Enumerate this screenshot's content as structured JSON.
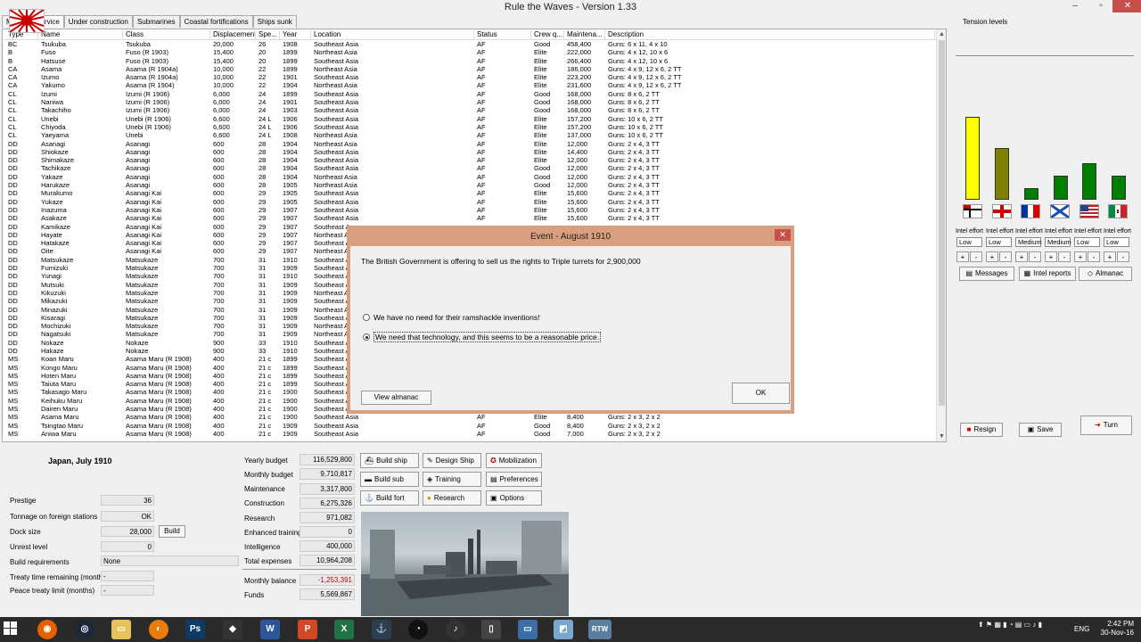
{
  "window": {
    "title": "Rule the Waves - Version 1.33",
    "controls": [
      "–",
      "▫",
      "✕"
    ]
  },
  "tabs": [
    "Map",
    "In service",
    "Under construction",
    "Submarines",
    "Coastal fortifications",
    "Ships sunk"
  ],
  "active_tab": "In service",
  "table": {
    "columns": [
      "Type",
      "Name",
      "Class",
      "Displacement",
      "Spe...",
      "Year",
      "Location",
      "Status",
      "Crew q...",
      "Maintena...",
      "Description"
    ],
    "rows": [
      [
        "BC",
        "Tsukuba",
        "Tsukuba",
        "20,000",
        "26",
        "1908",
        "Southeast Asia",
        "AF",
        "Good",
        "458,400",
        "Guns: 6 x 11, 4 x 10"
      ],
      [
        "B",
        "Fuso",
        "Fuso (R 1903)",
        "15,400",
        "20",
        "1899",
        "Northeast Asia",
        "AF",
        "Elite",
        "222,000",
        "Guns: 4 x 12, 10 x 6"
      ],
      [
        "B",
        "Hatsuse",
        "Fuso (R 1903)",
        "15,400",
        "20",
        "1899",
        "Southeast Asia",
        "AF",
        "Elite",
        "266,400",
        "Guns: 4 x 12, 10 x 6"
      ],
      [
        "CA",
        "Asama",
        "Asama (R 1904a)",
        "10,000",
        "22",
        "1899",
        "Northeast Asia",
        "AF",
        "Elite",
        "186,000",
        "Guns: 4 x 9, 12 x 6, 2 TT"
      ],
      [
        "CA",
        "Izumo",
        "Asama (R 1904a)",
        "10,000",
        "22",
        "1901",
        "Southeast Asia",
        "AF",
        "Elite",
        "223,200",
        "Guns: 4 x 9, 12 x 6, 2 TT"
      ],
      [
        "CA",
        "Yakumo",
        "Asama (R 1904)",
        "10,000",
        "22",
        "1904",
        "Northeast Asia",
        "AF",
        "Elite",
        "231,600",
        "Guns: 4 x 9, 12 x 6, 2 TT"
      ],
      [
        "CL",
        "Izumi",
        "Izumi (R 1906)",
        "6,000",
        "24",
        "1899",
        "Southeast Asia",
        "AF",
        "Good",
        "168,000",
        "Guns: 8 x 6, 2 TT"
      ],
      [
        "CL",
        "Naniwa",
        "Izumi (R 1906)",
        "6,000",
        "24",
        "1901",
        "Southeast Asia",
        "AF",
        "Good",
        "168,000",
        "Guns: 8 x 6, 2 TT"
      ],
      [
        "CL",
        "Takachiho",
        "Izumi (R 1906)",
        "6,000",
        "24",
        "1903",
        "Southeast Asia",
        "AF",
        "Good",
        "168,000",
        "Guns: 8 x 6, 2 TT"
      ],
      [
        "CL",
        "Unebi",
        "Unebi (R 1906)",
        "6,600",
        "24 L",
        "1906",
        "Southeast Asia",
        "AF",
        "Elite",
        "157,200",
        "Guns: 10 x 6, 2 TT"
      ],
      [
        "CL",
        "Chiyoda",
        "Unebi (R 1906)",
        "6,600",
        "24 L",
        "1906",
        "Southeast Asia",
        "AF",
        "Elite",
        "157,200",
        "Guns: 10 x 6, 2 TT"
      ],
      [
        "CL",
        "Yaeyama",
        "Unebi",
        "6,600",
        "24 L",
        "1908",
        "Northeast Asia",
        "AF",
        "Elite",
        "137,000",
        "Guns: 10 x 6, 2 TT"
      ],
      [
        "DD",
        "Asanagi",
        "Asanagi",
        "600",
        "28",
        "1904",
        "Northeast Asia",
        "AF",
        "Elite",
        "12,000",
        "Guns: 2 x 4, 3 TT"
      ],
      [
        "DD",
        "Shiokaze",
        "Asanagi",
        "600",
        "28",
        "1904",
        "Southeast Asia",
        "AF",
        "Elite",
        "14,400",
        "Guns: 2 x 4, 3 TT"
      ],
      [
        "DD",
        "Shimakaze",
        "Asanagi",
        "600",
        "28",
        "1904",
        "Southeast Asia",
        "AF",
        "Elite",
        "12,000",
        "Guns: 2 x 4, 3 TT"
      ],
      [
        "DD",
        "Tachikaze",
        "Asanagi",
        "600",
        "28",
        "1904",
        "Southeast Asia",
        "AF",
        "Good",
        "12,000",
        "Guns: 2 x 4, 3 TT"
      ],
      [
        "DD",
        "Yakaze",
        "Asanagi",
        "600",
        "28",
        "1904",
        "Northeast Asia",
        "AF",
        "Good",
        "12,000",
        "Guns: 2 x 4, 3 TT"
      ],
      [
        "DD",
        "Harukaze",
        "Asanagi",
        "600",
        "28",
        "1905",
        "Northeast Asia",
        "AF",
        "Good",
        "12,000",
        "Guns: 2 x 4, 3 TT"
      ],
      [
        "DD",
        "Murakumo",
        "Asanagi Kai",
        "600",
        "29",
        "1905",
        "Southeast Asia",
        "AF",
        "Elite",
        "15,600",
        "Guns: 2 x 4, 3 TT"
      ],
      [
        "DD",
        "Yukaze",
        "Asanagi Kai",
        "600",
        "29",
        "1905",
        "Southeast Asia",
        "AF",
        "Elite",
        "15,600",
        "Guns: 2 x 4, 3 TT"
      ],
      [
        "DD",
        "Inazuma",
        "Asanagi Kai",
        "600",
        "29",
        "1907",
        "Southeast Asia",
        "AF",
        "Elite",
        "15,600",
        "Guns: 2 x 4, 3 TT"
      ],
      [
        "DD",
        "Asakaze",
        "Asanagi Kai",
        "600",
        "29",
        "1907",
        "Southeast Asia",
        "AF",
        "Elite",
        "15,600",
        "Guns: 2 x 4, 3 TT"
      ],
      [
        "DD",
        "Kamikaze",
        "Asanagi Kai",
        "600",
        "29",
        "1907",
        "Southeast A",
        "",
        "",
        "",
        ""
      ],
      [
        "DD",
        "Hayate",
        "Asanagi Kai",
        "600",
        "29",
        "1907",
        "Northeast A",
        "",
        "",
        "",
        ""
      ],
      [
        "DD",
        "Hatakaze",
        "Asanagi Kai",
        "600",
        "29",
        "1907",
        "Southeast A",
        "",
        "",
        "",
        ""
      ],
      [
        "DD",
        "Oite",
        "Asanagi Kai",
        "600",
        "29",
        "1907",
        "Northeast A",
        "",
        "",
        "",
        ""
      ],
      [
        "DD",
        "Matsukaze",
        "Matsukaze",
        "700",
        "31",
        "1910",
        "Southeast A",
        "",
        "",
        "",
        ""
      ],
      [
        "DD",
        "Fumizuki",
        "Matsukaze",
        "700",
        "31",
        "1909",
        "Southeast A",
        "",
        "",
        "",
        ""
      ],
      [
        "DD",
        "Yunagi",
        "Matsukaze",
        "700",
        "31",
        "1910",
        "Southeast A",
        "",
        "",
        "",
        ""
      ],
      [
        "DD",
        "Mutsuki",
        "Matsukaze",
        "700",
        "31",
        "1909",
        "Southeast A",
        "",
        "",
        "",
        ""
      ],
      [
        "DD",
        "Kikuzuki",
        "Matsukaze",
        "700",
        "31",
        "1909",
        "Northeast A",
        "",
        "",
        "",
        ""
      ],
      [
        "DD",
        "Mikazuki",
        "Matsukaze",
        "700",
        "31",
        "1909",
        "Southeast A",
        "",
        "",
        "",
        ""
      ],
      [
        "DD",
        "Minazuki",
        "Matsukaze",
        "700",
        "31",
        "1909",
        "Northeast A",
        "",
        "",
        "",
        ""
      ],
      [
        "DD",
        "Kisaragi",
        "Matsukaze",
        "700",
        "31",
        "1909",
        "Southeast A",
        "",
        "",
        "",
        ""
      ],
      [
        "DD",
        "Mochizuki",
        "Matsukaze",
        "700",
        "31",
        "1909",
        "Northeast A",
        "",
        "",
        "",
        ""
      ],
      [
        "DD",
        "Nagatsuki",
        "Matsukaze",
        "700",
        "31",
        "1909",
        "Northeast A",
        "",
        "",
        "",
        ""
      ],
      [
        "DD",
        "Nokaze",
        "Nokaze",
        "900",
        "33",
        "1910",
        "Southeast A",
        "",
        "",
        "",
        ""
      ],
      [
        "DD",
        "Hakaze",
        "Nokaze",
        "900",
        "33",
        "1910",
        "Southeast A",
        "",
        "",
        "",
        ""
      ],
      [
        "MS",
        "Koan Maru",
        "Asama Maru (R 1908)",
        "400",
        "21 c",
        "1899",
        "Southeast A",
        "",
        "",
        "",
        ""
      ],
      [
        "MS",
        "Kongo Maru",
        "Asama Maru (R 1908)",
        "400",
        "21 c",
        "1899",
        "Southeast A",
        "",
        "",
        "",
        ""
      ],
      [
        "MS",
        "Hoten Maru",
        "Asama Maru (R 1908)",
        "400",
        "21 c",
        "1899",
        "Southeast A",
        "",
        "",
        "",
        ""
      ],
      [
        "MS",
        "Taiuta Maru",
        "Asama Maru (R 1908)",
        "400",
        "21 c",
        "1899",
        "Southeast A",
        "",
        "",
        "",
        ""
      ],
      [
        "MS",
        "Takasago Maru",
        "Asama Maru (R 1908)",
        "400",
        "21 c",
        "1900",
        "Southeast A",
        "",
        "",
        "",
        ""
      ],
      [
        "MS",
        "Keihuku Maru",
        "Asama Maru (R 1908)",
        "400",
        "21 c",
        "1900",
        "Southeast A",
        "",
        "",
        "",
        ""
      ],
      [
        "MS",
        "Dairen Maru",
        "Asama Maru (R 1908)",
        "400",
        "21 c",
        "1900",
        "Southeast A",
        "",
        "",
        "",
        ""
      ],
      [
        "MS",
        "Asama Maru",
        "Asama Maru (R 1908)",
        "400",
        "21 c",
        "1900",
        "Southeast Asia",
        "AF",
        "Elite",
        "8,400",
        "Guns: 2 x 3, 2 x 2"
      ],
      [
        "MS",
        "Tsingtao Maru",
        "Asama Maru (R 1908)",
        "400",
        "21 c",
        "1909",
        "Southeast Asia",
        "AF",
        "Good",
        "8,400",
        "Guns: 2 x 3, 2 x 2"
      ],
      [
        "MS",
        "Aniwa Maru",
        "Asama Maru (R 1908)",
        "400",
        "21 c",
        "1909",
        "Southeast Asia",
        "AF",
        "Good",
        "7,000",
        "Guns: 2 x 3, 2 x 2"
      ]
    ]
  },
  "tension": {
    "title": "Tension levels",
    "bars": [
      {
        "level": 0.59,
        "color": "#ffff00"
      },
      {
        "level": 0.37,
        "color": "#808000"
      },
      {
        "level": 0.08,
        "color": "#008000"
      },
      {
        "level": 0.17,
        "color": "#008000"
      },
      {
        "level": 0.26,
        "color": "#008000"
      },
      {
        "level": 0.17,
        "color": "#008000"
      }
    ],
    "nations": [
      "Germany",
      "Britain",
      "France",
      "Russia",
      "USA",
      "Italy"
    ],
    "intel_label": "Intel effort",
    "intel_levels": [
      "Low",
      "Low",
      "Medium",
      "Medium",
      "Low",
      "Low"
    ],
    "plus": "+",
    "minus": "-"
  },
  "right_buttons": {
    "messages": "Messages",
    "intel_reports": "Intel reports",
    "almanac": "Almanac",
    "resign": "Resign",
    "save": "Save",
    "turn": "Turn"
  },
  "nation": {
    "title": "Japan, July 1910",
    "stats": [
      {
        "label": "Prestige",
        "value": "36"
      },
      {
        "label": "Tonnage on foreign stations",
        "value": "OK"
      },
      {
        "label": "Dock size",
        "value": "28,000"
      },
      {
        "label": "Unrest level",
        "value": "0"
      },
      {
        "label": "Build requirements",
        "value": "None"
      },
      {
        "label": "Treaty time remaining (months)",
        "value": "-"
      },
      {
        "label": "Peace treaty limit (months)",
        "value": "-"
      }
    ],
    "build_button": "Build"
  },
  "budget": [
    {
      "label": "Yearly budget",
      "value": "116,529,800"
    },
    {
      "label": "Monthly budget",
      "value": "9,710,817"
    },
    {
      "label": "Maintenance",
      "value": "3,317,800"
    },
    {
      "label": "Construction",
      "value": "6,275,326"
    },
    {
      "label": "Research",
      "value": "971,082"
    },
    {
      "label": "Enhanced training",
      "value": "0"
    },
    {
      "label": "Intelligence",
      "value": "400,000"
    },
    {
      "label": "Total expenses",
      "value": "10,964,208"
    },
    {
      "label": "Monthly balance",
      "value": "-1,253,391"
    },
    {
      "label": "Funds",
      "value": "5,569,867"
    }
  ],
  "actions": {
    "build_ship": "Build ship",
    "design_ship": "Design Ship",
    "mobilization": "Mobilization",
    "build_sub": "Build sub",
    "training": "Training",
    "preferences": "Preferences",
    "build_fort": "Build fort",
    "research": "Research",
    "options": "Options"
  },
  "dialog": {
    "title": "Event - August 1910",
    "close": "✕",
    "message": "The British Government is offering to sell us the rights to Triple turrets for 2,900,000",
    "option1": "We have no need for their ramshackle inventions!",
    "option2": "We need that technology, and this seems to be a reasonable price.",
    "view_almanac": "View almanac",
    "ok": "OK"
  },
  "taskbar": {
    "apps": [
      "Firefox",
      "Steam",
      "Explorer",
      "Blender",
      "Photoshop",
      "Inkscape",
      "Word",
      "PowerPoint",
      "Excel",
      "Warships",
      "Obs",
      "Audio",
      "Notepad",
      "Photos",
      "Task",
      "RTW"
    ],
    "lang": "ENG",
    "time": "2:42 PM",
    "date": "30-Nov-16"
  }
}
